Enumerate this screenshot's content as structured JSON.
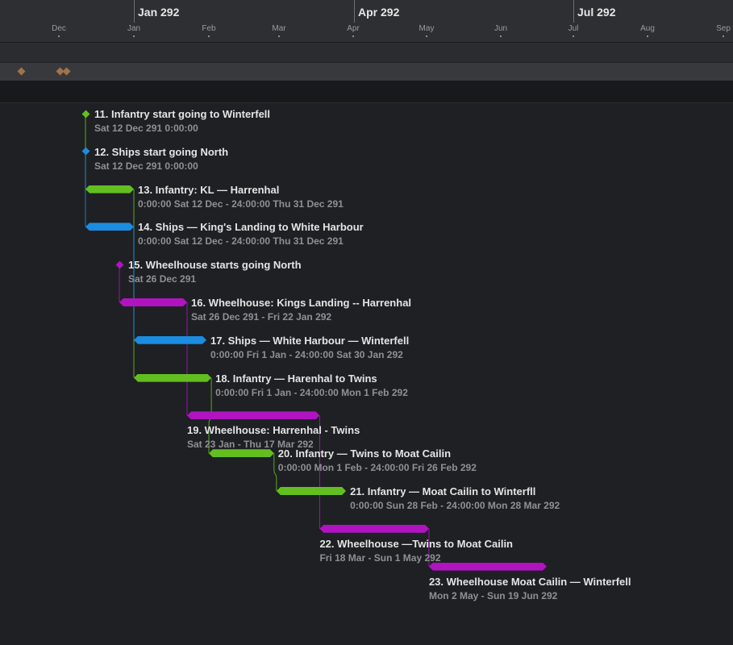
{
  "colors": {
    "infantry": "#63bf1f",
    "ships": "#1a8de0",
    "wheelhouse": "#b014c0",
    "overview_marker": "#a0744a"
  },
  "timeline": {
    "quarters": [
      "Jan 292",
      "Apr 292",
      "Jul 292"
    ],
    "months": [
      "Dec",
      "Jan",
      "Feb",
      "Mar",
      "Apr",
      "May",
      "Jun",
      "Jul",
      "Aug",
      "Sep"
    ]
  },
  "overview": {
    "marker_count": 3
  },
  "tasks": [
    {
      "id": "11",
      "kind": "milestone",
      "type": "infantry",
      "title": "11. Infantry start going to Winterfell",
      "dates": "Sat 12 Dec 291 0:00:00",
      "start": "291-12-12"
    },
    {
      "id": "12",
      "kind": "milestone",
      "type": "ships",
      "title": "12. Ships start going North",
      "dates": "Sat 12 Dec 291 0:00:00",
      "start": "291-12-12"
    },
    {
      "id": "13",
      "kind": "bar",
      "type": "infantry",
      "title": "13. Infantry: KL — Harrenhal",
      "dates": "0:00:00 Sat 12 Dec - 24:00:00 Thu 31 Dec 291",
      "start": "291-12-12",
      "end": "292-01-01"
    },
    {
      "id": "14",
      "kind": "bar",
      "type": "ships",
      "title": "14. Ships — King's Landing to White Harbour",
      "dates": "0:00:00 Sat 12 Dec - 24:00:00 Thu 31 Dec 291",
      "start": "291-12-12",
      "end": "292-01-01"
    },
    {
      "id": "15",
      "kind": "milestone",
      "type": "wheelhouse",
      "title": "15. Wheelhouse starts going North",
      "dates": "Sat 26 Dec 291",
      "start": "291-12-26"
    },
    {
      "id": "16",
      "kind": "bar",
      "type": "wheelhouse",
      "title": "16. Wheelhouse: Kings Landing -- Harrenhal",
      "dates": "Sat 26 Dec 291 - Fri 22 Jan 292",
      "start": "291-12-26",
      "end": "292-01-23"
    },
    {
      "id": "17",
      "kind": "bar",
      "type": "ships",
      "title": "17. Ships — White Harbour — Winterfell",
      "dates": "0:00:00 Fri 1 Jan - 24:00:00 Sat 30 Jan 292",
      "start": "292-01-01",
      "end": "292-01-31"
    },
    {
      "id": "18",
      "kind": "bar",
      "type": "infantry",
      "title": "18. Infantry — Harenhal to Twins",
      "dates": "0:00:00 Fri 1 Jan - 24:00:00 Mon 1 Feb 292",
      "start": "292-01-01",
      "end": "292-02-02"
    },
    {
      "id": "19",
      "kind": "bar",
      "type": "wheelhouse",
      "title": "19. Wheelhouse: Harrenhal - Twins",
      "dates": "Sat 23 Jan - Thu 17 Mar 292",
      "start": "292-01-23",
      "end": "292-03-18",
      "label_below": true
    },
    {
      "id": "20",
      "kind": "bar",
      "type": "infantry",
      "title": "20. Infantry — Twins to Moat Cailin",
      "dates": "0:00:00 Mon 1 Feb - 24:00:00 Fri 26 Feb 292",
      "start": "292-02-01",
      "end": "292-02-27"
    },
    {
      "id": "21",
      "kind": "bar",
      "type": "infantry",
      "title": "21. Infantry — Moat Cailin to Winterfll",
      "dates": "0:00:00 Sun 28 Feb - 24:00:00 Mon 28 Mar 292",
      "start": "292-02-28",
      "end": "292-03-29"
    },
    {
      "id": "22",
      "kind": "bar",
      "type": "wheelhouse",
      "title": "22. Wheelhouse —Twins to Moat Cailin",
      "dates": "Fri 18 Mar - Sun 1 May 292",
      "start": "292-03-18",
      "end": "292-05-02",
      "label_below": true
    },
    {
      "id": "23",
      "kind": "bar",
      "type": "wheelhouse",
      "title": "23. Wheelhouse Moat Cailin — Winterfell",
      "dates": "Mon 2 May - Sun 19 Jun 292",
      "start": "292-05-02",
      "end": "292-06-20",
      "label_below": true
    }
  ],
  "links": [
    [
      "11",
      "13"
    ],
    [
      "12",
      "14"
    ],
    [
      "13",
      "18"
    ],
    [
      "14",
      "17"
    ],
    [
      "15",
      "16"
    ],
    [
      "16",
      "19"
    ],
    [
      "18",
      "20"
    ],
    [
      "20",
      "21"
    ],
    [
      "19",
      "22"
    ],
    [
      "22",
      "23"
    ]
  ]
}
